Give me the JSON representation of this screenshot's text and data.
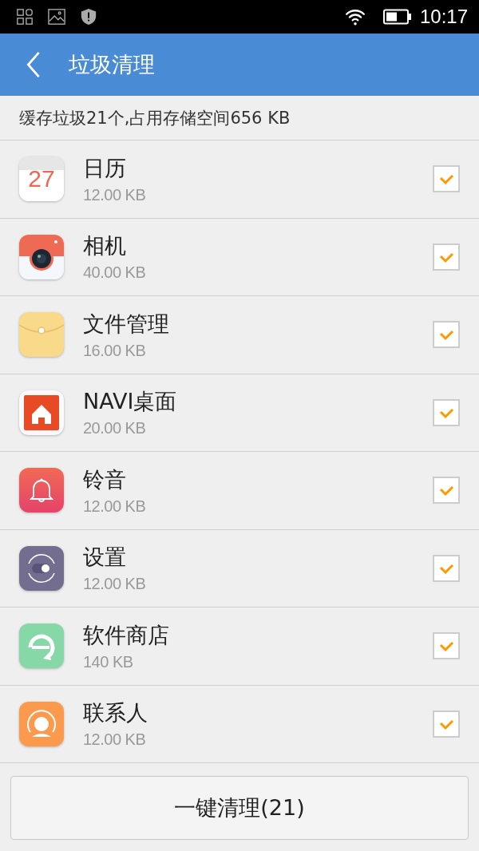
{
  "status_bar": {
    "time": "10:17"
  },
  "header": {
    "title": "垃圾清理"
  },
  "summary": "缓存垃圾21个,占用存储空间656 KB",
  "apps": [
    {
      "kind": "calendar",
      "icon_label": "27",
      "name": "日历",
      "size": "12.00 KB",
      "checked": true
    },
    {
      "kind": "camera",
      "name": "相机",
      "size": "40.00 KB",
      "checked": true
    },
    {
      "kind": "files",
      "name": "文件管理",
      "size": "16.00 KB",
      "checked": true
    },
    {
      "kind": "home",
      "name": "NAVI桌面",
      "size": "20.00 KB",
      "checked": true
    },
    {
      "kind": "bell",
      "name": "铃音",
      "size": "12.00 KB",
      "checked": true
    },
    {
      "kind": "settings",
      "name": "设置",
      "size": "12.00 KB",
      "checked": true
    },
    {
      "kind": "store",
      "name": "软件商店",
      "size": "140 KB",
      "checked": true
    },
    {
      "kind": "contacts",
      "name": "联系人",
      "size": "12.00 KB",
      "checked": true
    }
  ],
  "clean_button": "一键清理(21)"
}
